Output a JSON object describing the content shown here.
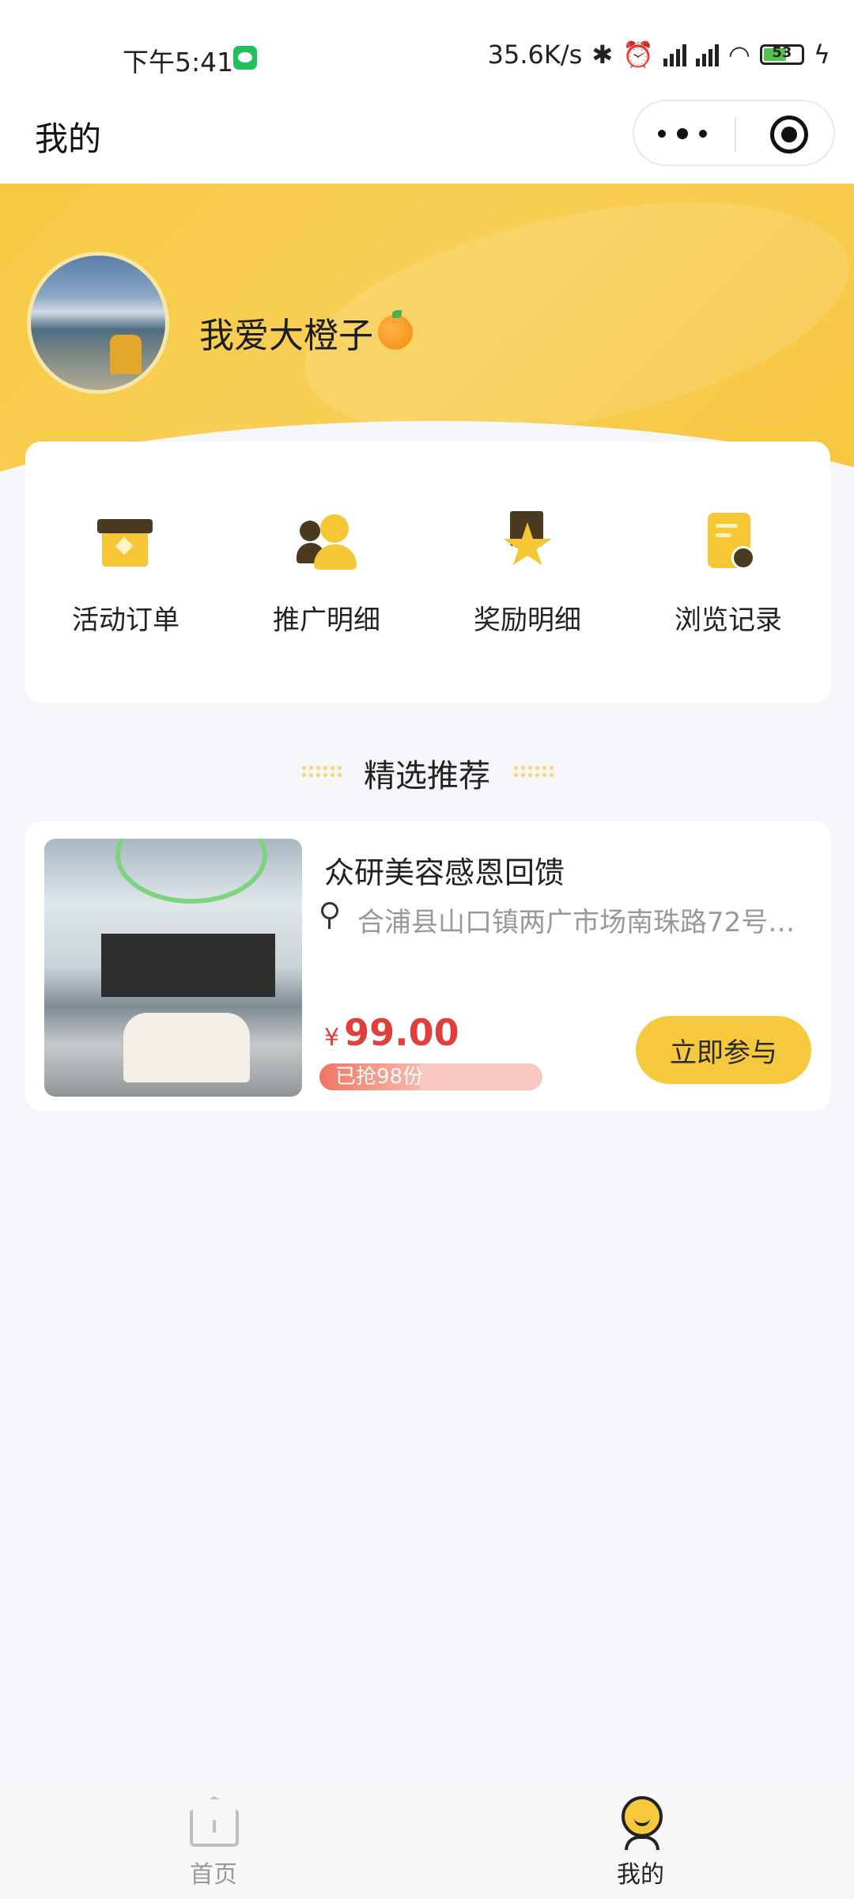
{
  "status_bar": {
    "time": "下午5:41",
    "network_speed": "35.6K/s",
    "battery": "53",
    "icons": [
      "wechat-icon",
      "bluetooth-icon",
      "alarm-icon",
      "hd-signal-icon",
      "hd-signal-icon",
      "wifi-icon",
      "battery-icon",
      "charging-icon"
    ]
  },
  "header": {
    "title": "我的",
    "capsule_icons": [
      "more-icon",
      "target-icon"
    ]
  },
  "profile": {
    "username": "我爱大橙子"
  },
  "quick_menu": [
    {
      "label": "活动订单",
      "icon": "gift-icon"
    },
    {
      "label": "推广明细",
      "icon": "users-icon"
    },
    {
      "label": "奖励明细",
      "icon": "award-icon"
    },
    {
      "label": "浏览记录",
      "icon": "history-icon"
    }
  ],
  "section": {
    "title": "精选推荐"
  },
  "product": {
    "title": "众研美容感恩回馈",
    "address": "合浦县山口镇两广市场南珠路72号…",
    "currency": "¥",
    "price": "99.00",
    "sold_text": "已抢98份",
    "sold_progress": 0.45,
    "button_label": "立即参与"
  },
  "tabbar": [
    {
      "label": "首页",
      "icon": "home-icon",
      "active": false,
      "color": "#9a9a9a"
    },
    {
      "label": "我的",
      "icon": "profile-icon",
      "active": true,
      "color": "#222222"
    }
  ],
  "colors": {
    "accent_yellow": "#F6C83E",
    "price_red": "#E0403A",
    "page_bg": "#F5F6FA"
  }
}
